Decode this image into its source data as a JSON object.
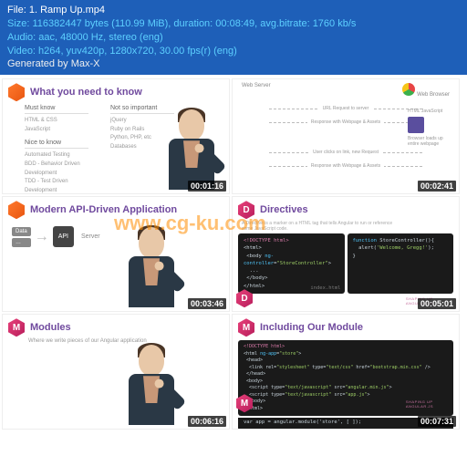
{
  "header": {
    "file_label": "File:",
    "filename": "1. Ramp Up.mp4",
    "size_line": "Size: 116382447 bytes (110.99 MiB), duration: 00:08:49, avg.bitrate: 1760 kb/s",
    "audio_line": "Audio: aac, 48000 Hz, stereo (eng)",
    "video_line": "Video: h264, yuv420p, 1280x720, 30.00 fps(r) (eng)",
    "generated": "Generated by Max-X"
  },
  "watermark": "www.cg-ku.com",
  "thumbs": [
    {
      "ts": "00:01:16",
      "title": "What you need to know",
      "cols": {
        "must": {
          "h": "Must know",
          "items": "HTML & CSS\nJavaScript"
        },
        "notso": {
          "h": "Not so important",
          "items": "jQuery\nRuby on Rails\nPython, PHP, etc\nDatabases"
        },
        "nice": {
          "h": "Nice to know",
          "items": "Automated Testing\nBDD - Behavior Driven Development\nTDD - Test Driven Development\netc"
        }
      }
    },
    {
      "ts": "00:02:41",
      "labels": {
        "server": "Web Server",
        "browser": "Web Browser",
        "html": "HTML JavaScript"
      },
      "lines": {
        "l1": "URL Request to server",
        "l2": "Response with Webpage & Assets",
        "l3": "User clicks on link, new Request",
        "l4": "Response with Webpage & Assets"
      },
      "side": "Browser loads up entire webpage"
    },
    {
      "ts": "00:03:46",
      "title": "Modern API-Driven Application",
      "server": "Server",
      "boxes": {
        "data": "Data",
        "api": "API"
      }
    },
    {
      "ts": "00:05:01",
      "title": "Directives",
      "caption": "A Directive is a marker on a HTML tag that tells Angular to run or reference",
      "sub": "some JavaScript code.",
      "code_left": "<!DOCTYPE html>\n<html>\n<body ng-controller=\"StoreController\">\n  ...\n</body>\n</html>",
      "code_right": "function StoreController(){\n  alert('Welcome, Gregg!');\n}",
      "file": "index.html",
      "brand": "Shaping Up\nAngular.js"
    },
    {
      "ts": "00:06:16",
      "title": "Modules",
      "sub": "Where we write pieces of our Angular application"
    },
    {
      "ts": "00:07:31",
      "title": "Including Our Module",
      "code": "<!DOCTYPE html>\n<html ng-app=\"store\">\n<head>\n  <link rel=\"stylesheet\" type=\"text/css\" href=\"bootstrap.min.css\" />\n</head>\n<body>\n  <script type=\"text/javascript\" src=\"angular.min.js\">\n  <script type=\"text/javascript\" src=\"app.js\">\n</body>\n</html>",
      "bottom": "var app = angular.module('store', [ ]);",
      "brand": "Shaping Up\nAngular.js"
    }
  ]
}
